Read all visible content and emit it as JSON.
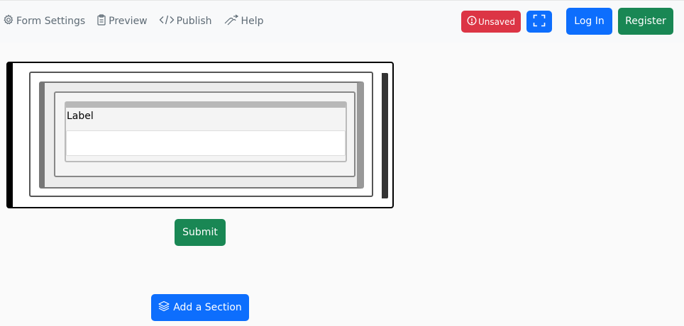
{
  "nav": {
    "form_settings": "Form Settings",
    "preview": "Preview",
    "publish": "Publish",
    "help": "Help"
  },
  "status": {
    "unsaved": "Unsaved"
  },
  "auth": {
    "login": "Log In",
    "register": "Register"
  },
  "form": {
    "field_label": "Label",
    "field_value": "",
    "submit": "Submit"
  },
  "actions": {
    "add_section": "Add a Section"
  },
  "colors": {
    "primary": "#0d6efd",
    "success": "#198754",
    "danger": "#dc3545",
    "nav_text": "#5e6b75"
  },
  "icons": [
    "gear-icon",
    "clipboard-icon",
    "code-icon",
    "help-icon",
    "alert-circle-icon",
    "fullscreen-icon",
    "layers-icon"
  ]
}
